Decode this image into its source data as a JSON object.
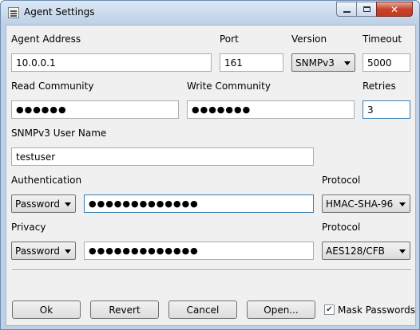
{
  "window": {
    "title": "Agent Settings"
  },
  "labels": {
    "agent_address": "Agent Address",
    "port": "Port",
    "version": "Version",
    "timeout": "Timeout",
    "read_community": "Read Community",
    "write_community": "Write Community",
    "retries": "Retries",
    "snmpv3_user_name": "SNMPv3 User Name",
    "authentication": "Authentication",
    "auth_protocol": "Protocol",
    "privacy": "Privacy",
    "priv_protocol": "Protocol"
  },
  "fields": {
    "agent_address": "10.0.0.1",
    "port": "161",
    "version": "SNMPv3",
    "timeout": "5000",
    "read_community": "●●●●●●",
    "write_community": "●●●●●●●",
    "retries": "3",
    "snmpv3_user_name": "testuser",
    "authentication_mode": "Password",
    "authentication_password": "●●●●●●●●●●●●●",
    "auth_protocol": "HMAC-SHA-96",
    "privacy_mode": "Password",
    "privacy_password": "●●●●●●●●●●●●●",
    "priv_protocol": "AES128/CFB"
  },
  "buttons": {
    "ok": "Ok",
    "revert": "Revert",
    "cancel": "Cancel",
    "open": "Open...",
    "mask_passwords": "Mask Passwords"
  },
  "mask_passwords_checked": true,
  "icons": {
    "app": "app-window-icon",
    "minimize": "minimize-icon",
    "maximize": "maximize-icon",
    "close": "close-icon",
    "dropdown": "chevron-down-icon",
    "check": "checkmark-icon"
  }
}
